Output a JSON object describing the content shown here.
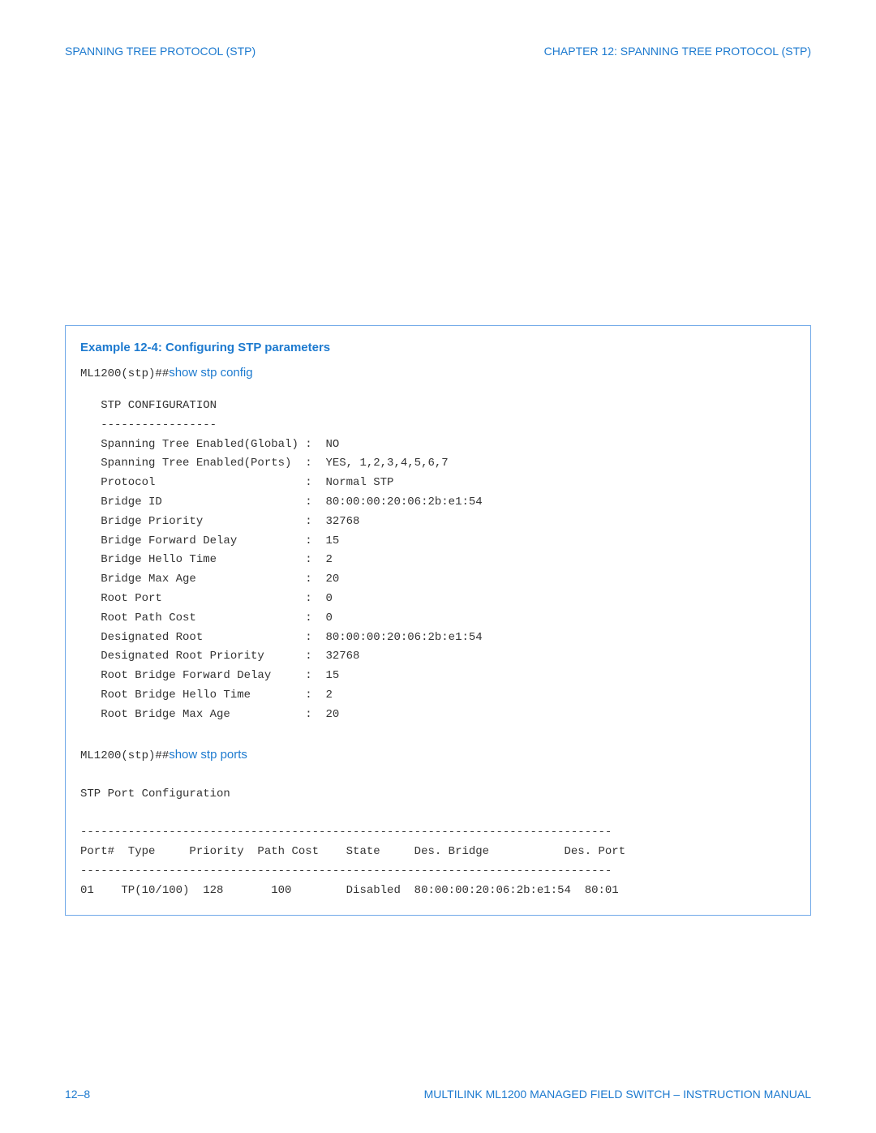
{
  "header": {
    "left": "SPANNING TREE PROTOCOL (STP)",
    "right": "CHAPTER 12: SPANNING TREE PROTOCOL (STP)"
  },
  "example": {
    "title": "Example 12-4: Configuring STP parameters",
    "prompt1": "ML1200(stp)##",
    "cmd1": "show stp config",
    "config_block": "   STP CONFIGURATION\n   -----------------\n   Spanning Tree Enabled(Global) :  NO\n   Spanning Tree Enabled(Ports)  :  YES, 1,2,3,4,5,6,7\n   Protocol                      :  Normal STP\n   Bridge ID                     :  80:00:00:20:06:2b:e1:54\n   Bridge Priority               :  32768\n   Bridge Forward Delay          :  15\n   Bridge Hello Time             :  2\n   Bridge Max Age                :  20\n   Root Port                     :  0\n   Root Path Cost                :  0\n   Designated Root               :  80:00:00:20:06:2b:e1:54\n   Designated Root Priority      :  32768\n   Root Bridge Forward Delay     :  15\n   Root Bridge Hello Time        :  2\n   Root Bridge Max Age           :  20",
    "prompt2": "ML1200(stp)##",
    "cmd2": "show stp ports",
    "ports_block": "STP Port Configuration\n\n------------------------------------------------------------------------------\nPort#  Type     Priority  Path Cost    State     Des. Bridge           Des. Port\n------------------------------------------------------------------------------\n01    TP(10/100)  128       100        Disabled  80:00:00:20:06:2b:e1:54  80:01"
  },
  "footer": {
    "left": "12–8",
    "right": "MULTILINK ML1200 MANAGED FIELD SWITCH – INSTRUCTION MANUAL"
  }
}
